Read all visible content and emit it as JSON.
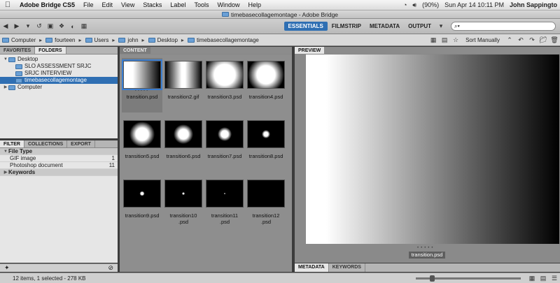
{
  "menubar": {
    "app": "Adobe Bridge CS5",
    "items": [
      "File",
      "Edit",
      "View",
      "Stacks",
      "Label",
      "Tools",
      "Window",
      "Help"
    ],
    "battery": "(90%)",
    "clock": "Sun Apr 14  10:11 PM",
    "user": "John Sappingto"
  },
  "window": {
    "title": "timebasecollagemontage - Adobe Bridge"
  },
  "toolbar": {
    "workspaces": [
      "ESSENTIALS",
      "FILMSTRIP",
      "METADATA",
      "OUTPUT"
    ],
    "search_placeholder": "⌕▾"
  },
  "path": {
    "crumbs": [
      "Computer",
      "fourteen",
      "Users",
      "john",
      "Desktop",
      "timebasecollagemontage"
    ],
    "sort": "Sort Manually"
  },
  "left_top": {
    "tabs": [
      "FAVORITES",
      "FOLDERS"
    ],
    "tree": [
      {
        "label": "Desktop",
        "indent": 0,
        "open": true
      },
      {
        "label": "SLO ASSESSMENT SRJC",
        "indent": 1
      },
      {
        "label": "SRJC INTERVIEW",
        "indent": 1
      },
      {
        "label": "timebasecollagemontage",
        "indent": 1,
        "selected": true
      },
      {
        "label": "Computer",
        "indent": 0
      }
    ]
  },
  "left_bottom": {
    "tabs": [
      "FILTER",
      "COLLECTIONS",
      "EXPORT"
    ],
    "file_type": "File Type",
    "rows": [
      {
        "label": "GIF image",
        "count": "1"
      },
      {
        "label": "Photoshop document",
        "count": "11"
      }
    ],
    "keywords": "Keywords"
  },
  "content": {
    "tab": "CONTENT",
    "items": [
      {
        "name": "transition.psd",
        "kind": "linear",
        "selected": true
      },
      {
        "name": "transition2.gif",
        "kind": "linear2"
      },
      {
        "name": "transition3.psd",
        "kind": "radial",
        "size": 60
      },
      {
        "name": "transition4.psd",
        "kind": "radial",
        "size": 52
      },
      {
        "name": "transition5.psd",
        "kind": "radial",
        "size": 36
      },
      {
        "name": "transition6.psd",
        "kind": "radial",
        "size": 28
      },
      {
        "name": "transition7.psd",
        "kind": "radial",
        "size": 20
      },
      {
        "name": "transition8.psd",
        "kind": "radial",
        "size": 12
      },
      {
        "name": "transition9.psd",
        "kind": "radial",
        "size": 7
      },
      {
        "name": "transition10\n.psd",
        "kind": "radial",
        "size": 4
      },
      {
        "name": "transition11\n.psd",
        "kind": "radial",
        "size": 2
      },
      {
        "name": "transition12\n.psd",
        "kind": "black"
      }
    ]
  },
  "preview": {
    "tab": "PREVIEW",
    "label": "transition.psd"
  },
  "bottom_tabs": [
    "METADATA",
    "KEYWORDS"
  ],
  "status": {
    "text": "12 items, 1 selected - 278 KB"
  }
}
